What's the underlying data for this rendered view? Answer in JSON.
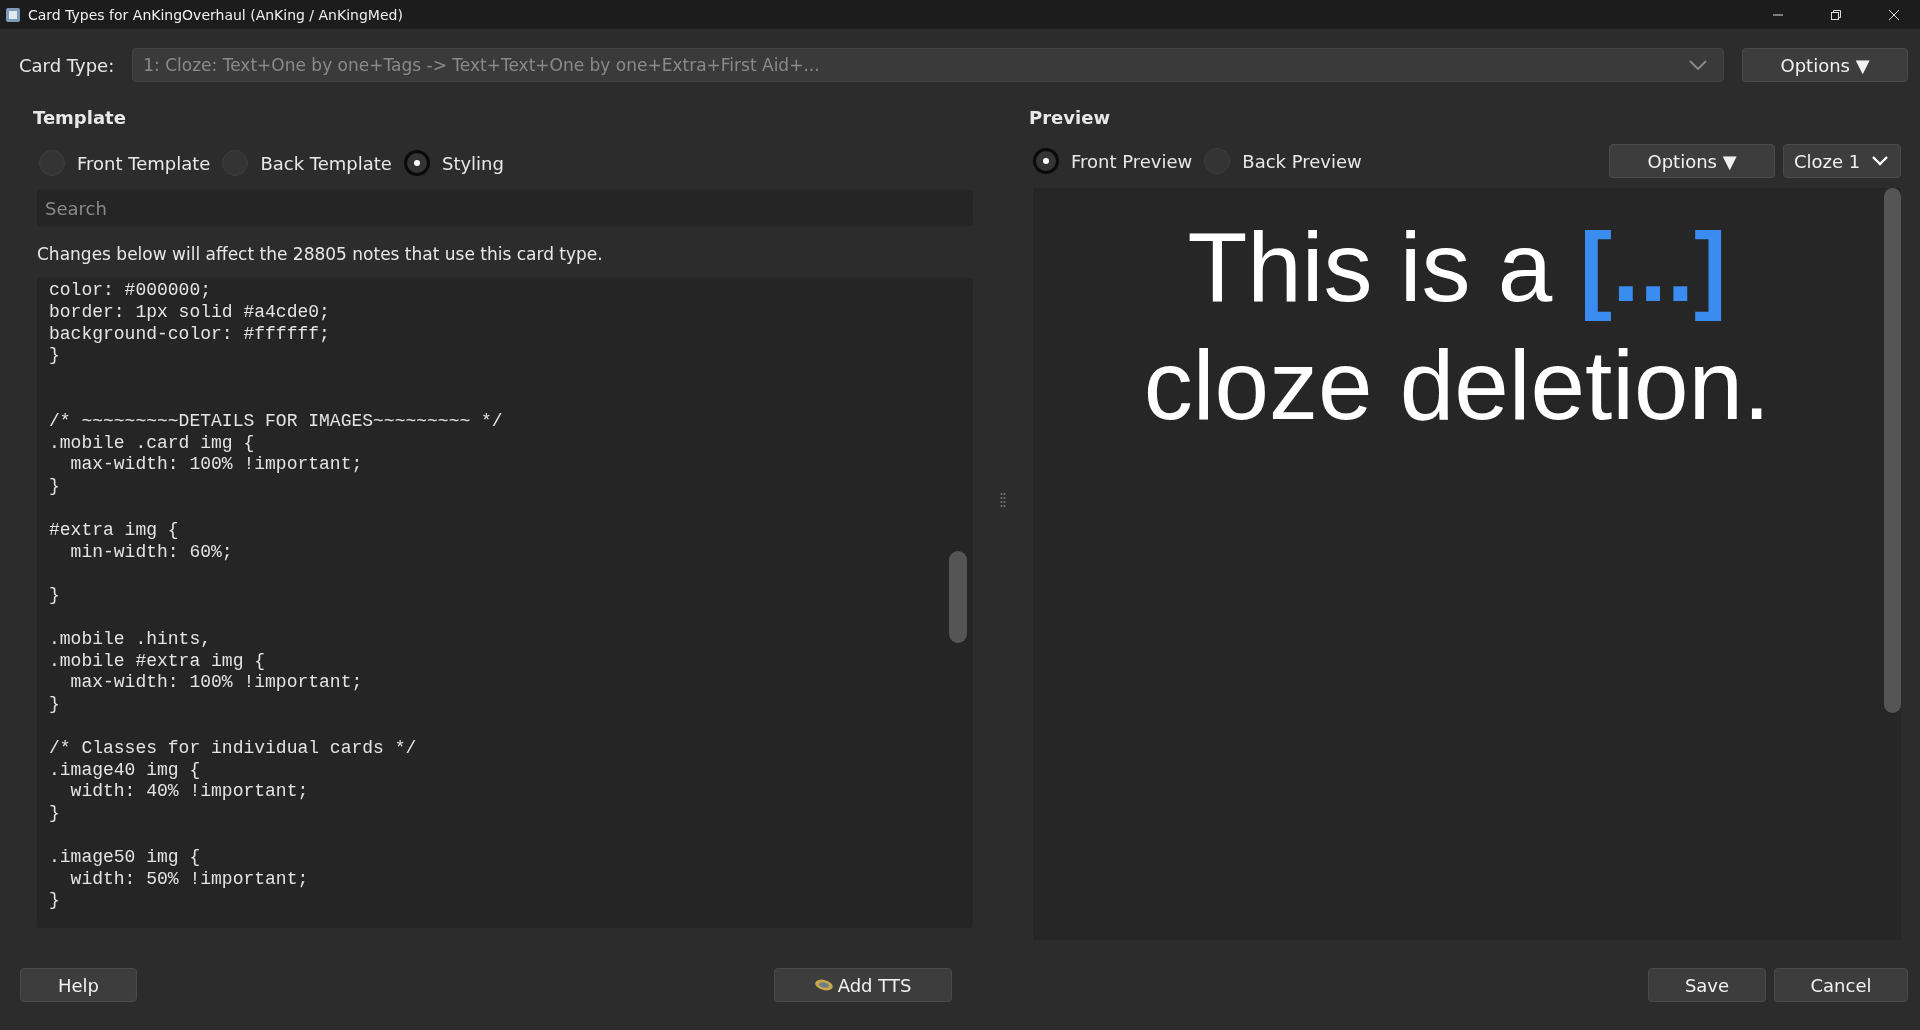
{
  "window": {
    "title": "Card Types for AnKingOverhaul (AnKing / AnKingMed)"
  },
  "card_type": {
    "label": "Card Type:",
    "value": "1: Cloze: Text+One by one+Tags -> Text+Text+One by one+Extra+First Aid+...",
    "options_button": "Options ▼"
  },
  "template": {
    "heading": "Template",
    "radios": [
      {
        "label": "Front Template",
        "selected": false
      },
      {
        "label": "Back Template",
        "selected": false
      },
      {
        "label": "Styling",
        "selected": true
      }
    ],
    "search": {
      "placeholder": "Search"
    },
    "notice": "Changes below will affect the 28805 notes that use this card type.",
    "code": "color: #000000;\nborder: 1px solid #a4cde0;\nbackground-color: #ffffff;\n}\n\n\n/* ~~~~~~~~~DETAILS FOR IMAGES~~~~~~~~~ */\n.mobile .card img {\n  max-width: 100% !important;\n}\n\n#extra img {\n  min-width: 60%;\n\n}\n\n.mobile .hints,\n.mobile #extra img {\n  max-width: 100% !important;\n}\n\n/* Classes for individual cards */\n.image40 img {\n  width: 40% !important;\n}\n\n.image50 img {\n  width: 50% !important;\n}"
  },
  "preview": {
    "heading": "Preview",
    "radios": [
      {
        "label": "Front Preview",
        "selected": true
      },
      {
        "label": "Back Preview",
        "selected": false
      }
    ],
    "options_button": "Options ▼",
    "card_select": "Cloze 1",
    "lines": [
      [
        {
          "kind": "plain",
          "text": "This is a "
        },
        {
          "kind": "cloze",
          "text": "[...]"
        }
      ],
      [
        {
          "kind": "plain",
          "text": "cloze deletion."
        }
      ]
    ]
  },
  "buttons": {
    "help": "Help",
    "add_tts": "Add TTS",
    "save": "Save",
    "cancel": "Cancel"
  }
}
